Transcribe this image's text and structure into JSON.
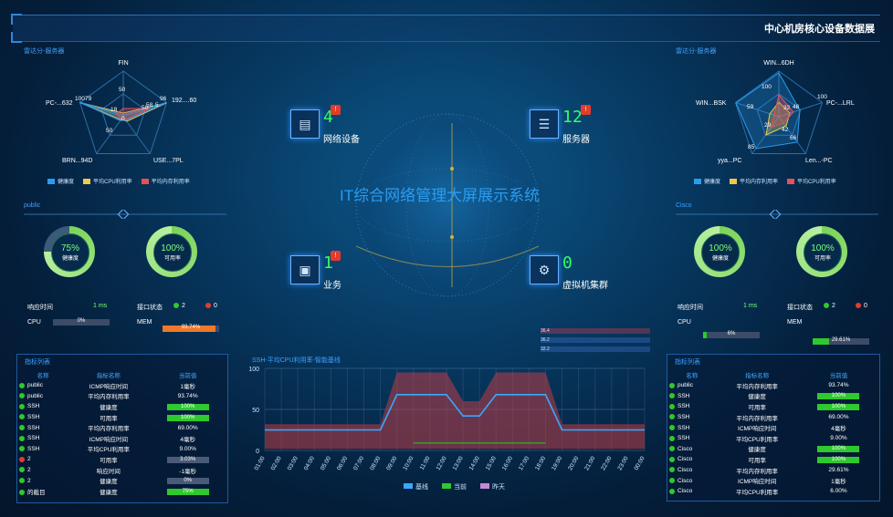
{
  "header": {
    "title": "中心机房核心设备数据展"
  },
  "center_title": "IT综合网络管理大屏展示系统",
  "radar_left": {
    "title": "雷达分-服务器",
    "axes": [
      "FIN",
      "192....60",
      "USE...7PL",
      "BRN...94D",
      "PC-...632"
    ],
    "labels": [
      "100",
      "50",
      "0",
      "79",
      "18",
      "50",
      "96",
      "50",
      "58",
      "5"
    ],
    "legend": [
      "健康度",
      "平均CPU利用率",
      "平均内存利用率"
    ],
    "colors": [
      "#2a9cf0",
      "#f0c84a",
      "#e6505a"
    ]
  },
  "radar_right": {
    "title": "雷达分-服务器",
    "axes": [
      "WIN...6DH",
      "PC-...LRL",
      "Len...-PC",
      "yya...PC",
      "WIN...BSK"
    ],
    "labels": [
      "100",
      "59",
      "32",
      "48",
      "29",
      "42",
      "66",
      "85",
      "100"
    ],
    "legend": [
      "健康度",
      "平均内存利用率",
      "平均CPU利用率"
    ],
    "colors": [
      "#2a9cf0",
      "#f0c84a",
      "#e6505a"
    ]
  },
  "left_status": {
    "title": "public",
    "health": {
      "value": "75%",
      "label": "健康度",
      "fraction": 0.75
    },
    "avail": {
      "value": "100%",
      "label": "可用率",
      "fraction": 1.0
    },
    "resp_label": "响应时间",
    "resp_value": "1 ms",
    "port_label": "接口状态",
    "port_up": "2",
    "port_down": "0",
    "cpu_label": "CPU",
    "cpu_value": "0%",
    "cpu_fraction": 0.0,
    "mem_label": "MEM",
    "mem_value": "93.74%",
    "mem_fraction": 0.9374
  },
  "right_status": {
    "title": "Cisco",
    "health": {
      "value": "100%",
      "label": "健康度",
      "fraction": 1.0
    },
    "avail": {
      "value": "100%",
      "label": "可用率",
      "fraction": 1.0
    },
    "resp_label": "响应时间",
    "resp_value": "1 ms",
    "port_label": "接口状态",
    "port_up": "2",
    "port_down": "0",
    "cpu_label": "CPU",
    "cpu_value": "6%",
    "cpu_fraction": 0.06,
    "mem_label": "MEM",
    "mem_value": "29.61%",
    "mem_fraction": 0.2961
  },
  "devices": [
    {
      "name": "网络设备",
      "count": "4",
      "badge": "!"
    },
    {
      "name": "服务器",
      "count": "12",
      "badge": "!"
    },
    {
      "name": "业务",
      "count": "1",
      "badge": "!"
    },
    {
      "name": "虚拟机集群",
      "count": "0",
      "badge": ""
    }
  ],
  "left_table": {
    "title": "指标列表",
    "headers": [
      "名称",
      "指标名称",
      "当前值"
    ],
    "rows": [
      {
        "name": "public",
        "metric": "ICMP响应时间",
        "value": "1毫秒",
        "dot": "#2ec92e",
        "bar": ""
      },
      {
        "name": "public",
        "metric": "平均内存利用率",
        "value": "93.74%",
        "dot": "#2ec92e",
        "bar": ""
      },
      {
        "name": "SSH",
        "metric": "健康度",
        "value": "100%",
        "dot": "#2ec92e",
        "bar": "#2ec92e"
      },
      {
        "name": "SSH",
        "metric": "可用率",
        "value": "100%",
        "dot": "#2ec92e",
        "bar": "#2ec92e"
      },
      {
        "name": "SSH",
        "metric": "平均内存利用率",
        "value": "69.00%",
        "dot": "#2ec92e",
        "bar": ""
      },
      {
        "name": "SSH",
        "metric": "ICMP响应时间",
        "value": "4毫秒",
        "dot": "#2ec92e",
        "bar": ""
      },
      {
        "name": "SSH",
        "metric": "平均CPU利用率",
        "value": "9.00%",
        "dot": "#2ec92e",
        "bar": ""
      },
      {
        "name": "2",
        "metric": "可用率",
        "value": "3.03%",
        "dot": "#e53b2b",
        "bar": "#4a5a78"
      },
      {
        "name": "2",
        "metric": "响应时间",
        "value": "-1毫秒",
        "dot": "#2ec92e",
        "bar": ""
      },
      {
        "name": "2",
        "metric": "健康度",
        "value": "0%",
        "dot": "#2ec92e",
        "bar": "#4a5a78"
      },
      {
        "name": "的截目",
        "metric": "健康度",
        "value": "75%",
        "dot": "#2ec92e",
        "bar": "#2ec92e"
      }
    ]
  },
  "right_table": {
    "title": "指标列表",
    "headers": [
      "名称",
      "指标名称",
      "当前值"
    ],
    "rows": [
      {
        "name": "public",
        "metric": "平均内存利用率",
        "value": "93.74%",
        "dot": "#2ec92e",
        "bar": ""
      },
      {
        "name": "SSH",
        "metric": "健康度",
        "value": "100%",
        "dot": "#2ec92e",
        "bar": "#2ec92e"
      },
      {
        "name": "SSH",
        "metric": "可用率",
        "value": "100%",
        "dot": "#2ec92e",
        "bar": "#2ec92e"
      },
      {
        "name": "SSH",
        "metric": "平均内存利用率",
        "value": "69.00%",
        "dot": "#2ec92e",
        "bar": ""
      },
      {
        "name": "SSH",
        "metric": "ICMP响应时间",
        "value": "4毫秒",
        "dot": "#2ec92e",
        "bar": ""
      },
      {
        "name": "SSH",
        "metric": "平均CPU利用率",
        "value": "9.00%",
        "dot": "#2ec92e",
        "bar": ""
      },
      {
        "name": "Cisco",
        "metric": "健康度",
        "value": "100%",
        "dot": "#2ec92e",
        "bar": "#2ec92e"
      },
      {
        "name": "Cisco",
        "metric": "可用率",
        "value": "100%",
        "dot": "#2ec92e",
        "bar": "#2ec92e"
      },
      {
        "name": "Cisco",
        "metric": "平均内存利用率",
        "value": "29.61%",
        "dot": "#2ec92e",
        "bar": ""
      },
      {
        "name": "Cisco",
        "metric": "ICMP响应时间",
        "value": "1毫秒",
        "dot": "#2ec92e",
        "bar": ""
      },
      {
        "name": "Cisco",
        "metric": "平均CPU利用率",
        "value": "6.00%",
        "dot": "#2ec92e",
        "bar": ""
      }
    ]
  },
  "chart_data": {
    "type": "area",
    "title": "SSH-平均CPU利用率-智能基线",
    "xlabel": "",
    "ylabel": "",
    "x": [
      "01:00",
      "02:00",
      "03:00",
      "04:00",
      "05:00",
      "06:00",
      "07:00",
      "08:00",
      "09:00",
      "10:00",
      "11:00",
      "12:00",
      "13:00",
      "14:00",
      "15:00",
      "16:00",
      "17:00",
      "18:00",
      "19:00",
      "20:00",
      "21:00",
      "22:00",
      "23:00",
      "00:00"
    ],
    "ylim": [
      0,
      100
    ],
    "yticks": [
      "0",
      "50",
      "100"
    ],
    "series": [
      {
        "name": "基线",
        "color": "#3aa8ff",
        "values": [
          25,
          25,
          25,
          25,
          25,
          25,
          25,
          25,
          68,
          68,
          68,
          68,
          42,
          42,
          68,
          68,
          68,
          68,
          25,
          25,
          25,
          25,
          25,
          25
        ]
      },
      {
        "name": "当前",
        "color": "#2ec92e",
        "values": [
          null,
          null,
          null,
          null,
          null,
          null,
          null,
          null,
          null,
          9,
          9,
          9,
          9,
          9,
          9,
          9,
          9,
          9,
          null,
          null,
          null,
          null,
          null,
          null
        ]
      },
      {
        "name": "昨天",
        "color": "#c48ad8",
        "values": [
          null,
          null,
          null,
          null,
          null,
          null,
          null,
          null,
          null,
          null,
          null,
          null,
          null,
          null,
          null,
          null,
          null,
          9,
          null,
          null,
          null,
          null,
          null,
          null
        ]
      }
    ],
    "band_upper": [
      32,
      32,
      32,
      32,
      32,
      32,
      32,
      32,
      95,
      95,
      95,
      95,
      60,
      60,
      95,
      95,
      95,
      95,
      32,
      32,
      32,
      32,
      32,
      32
    ],
    "band_lower": [
      2,
      2,
      2,
      2,
      2,
      2,
      2,
      2,
      2,
      2,
      2,
      2,
      2,
      2,
      2,
      2,
      2,
      2,
      2,
      2,
      2,
      2,
      2,
      2
    ],
    "legend": [
      "基线",
      "当前",
      "昨天"
    ],
    "grid": true
  },
  "mini_bars": {
    "labels": [
      "36.4",
      "36.2",
      "32.2"
    ]
  }
}
